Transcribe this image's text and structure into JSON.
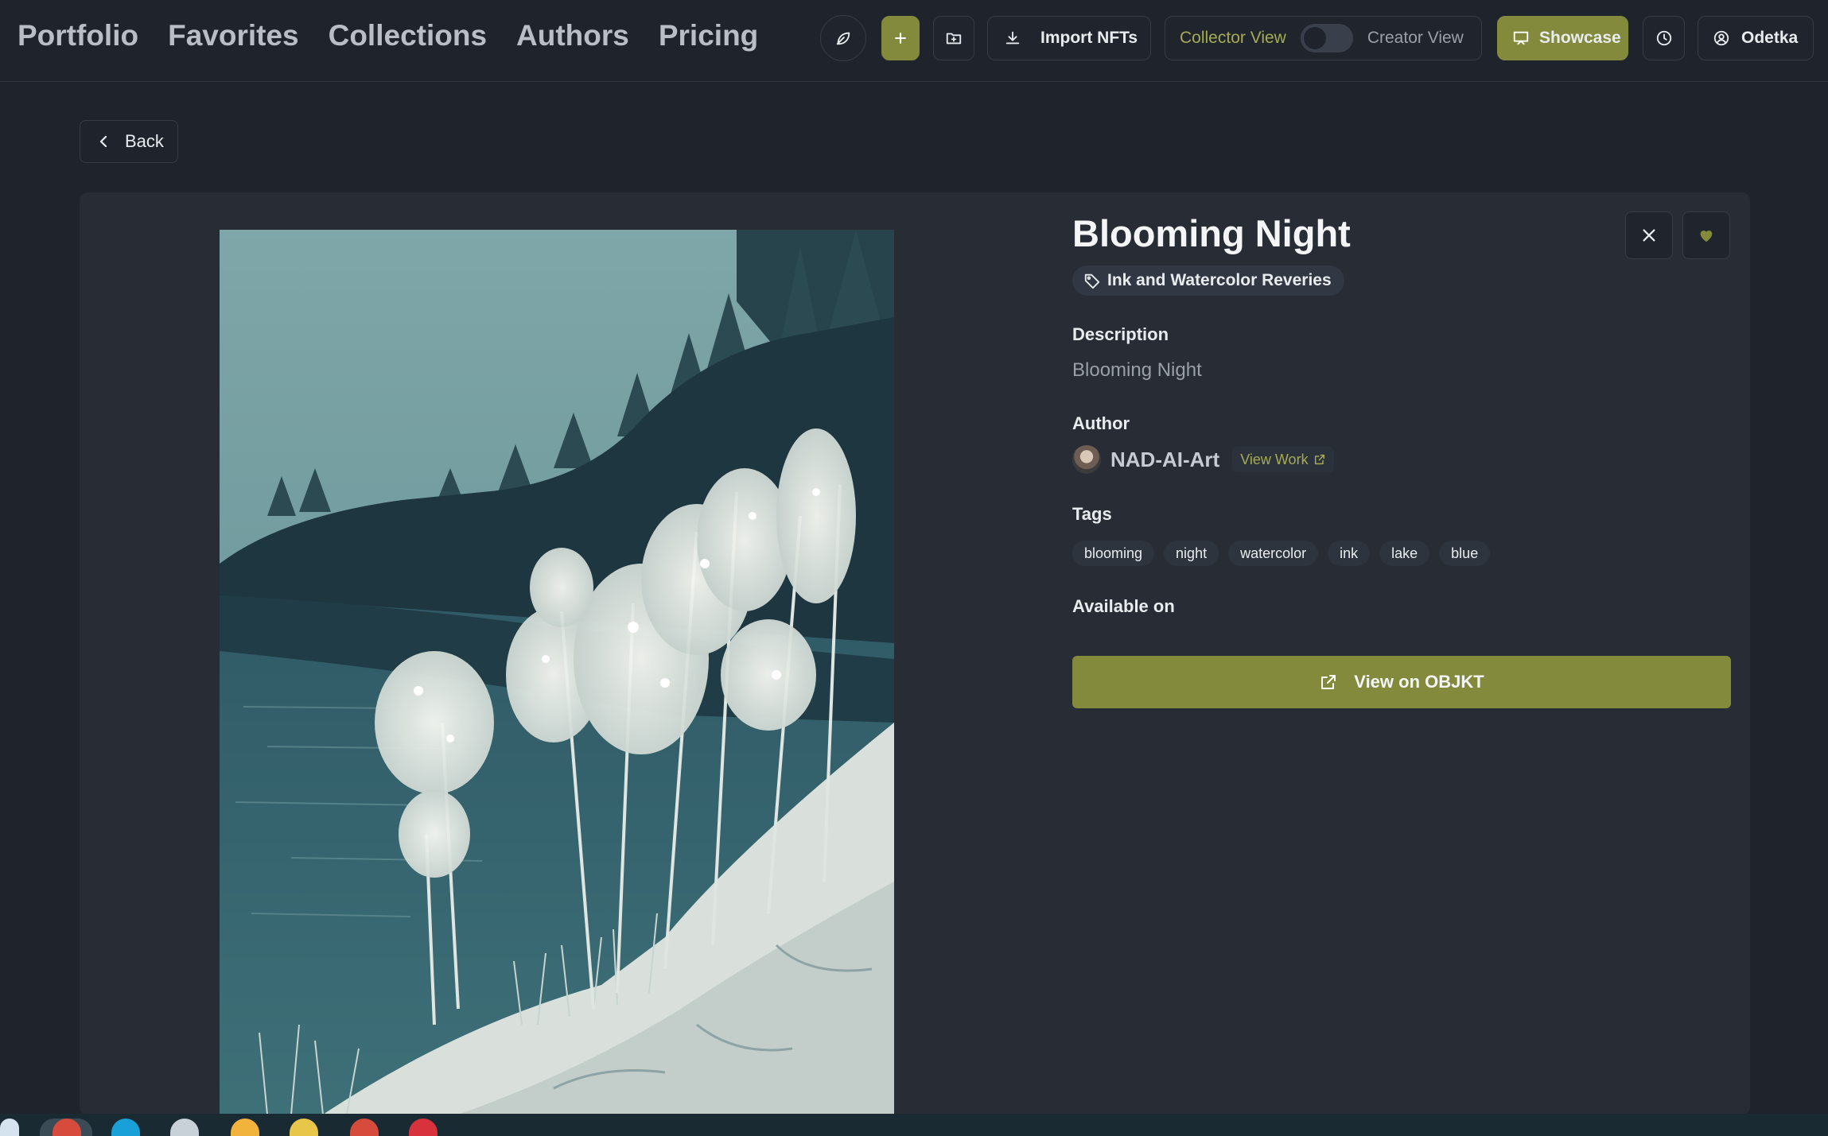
{
  "nav": {
    "links": [
      "Portfolio",
      "Favorites",
      "Collections",
      "Authors",
      "Pricing"
    ]
  },
  "toolbar": {
    "import_label": "Import NFTs",
    "collector_label": "Collector View",
    "creator_label": "Creator View",
    "showcase_label": "Showcase",
    "user_label": "Odetka"
  },
  "back_label": "Back",
  "nft": {
    "title": "Blooming Night",
    "collection": "Ink and Watercolor Reveries",
    "description_heading": "Description",
    "description": "Blooming Night",
    "author_heading": "Author",
    "author_name": "NAD-AI-Art",
    "view_work_label": "View Work",
    "tags_heading": "Tags",
    "tags": [
      "blooming",
      "night",
      "watercolor",
      "ink",
      "lake",
      "blue"
    ],
    "available_heading": "Available on",
    "marketplace_label": "View on OBJKT"
  },
  "colors": {
    "background": "#1f242c",
    "card": "#272c35",
    "accent": "#838a3b",
    "accent_text": "#a4ab55"
  },
  "icons": {
    "leaf": "leaf-icon",
    "plus": "plus-icon",
    "folder": "folder-plus-icon",
    "import": "download-icon",
    "showcase": "presentation-icon",
    "history": "clock-icon",
    "user": "user-circle-icon",
    "close": "close-icon",
    "favorite": "heart-icon",
    "collection": "tag-icon",
    "external": "external-link-icon"
  }
}
